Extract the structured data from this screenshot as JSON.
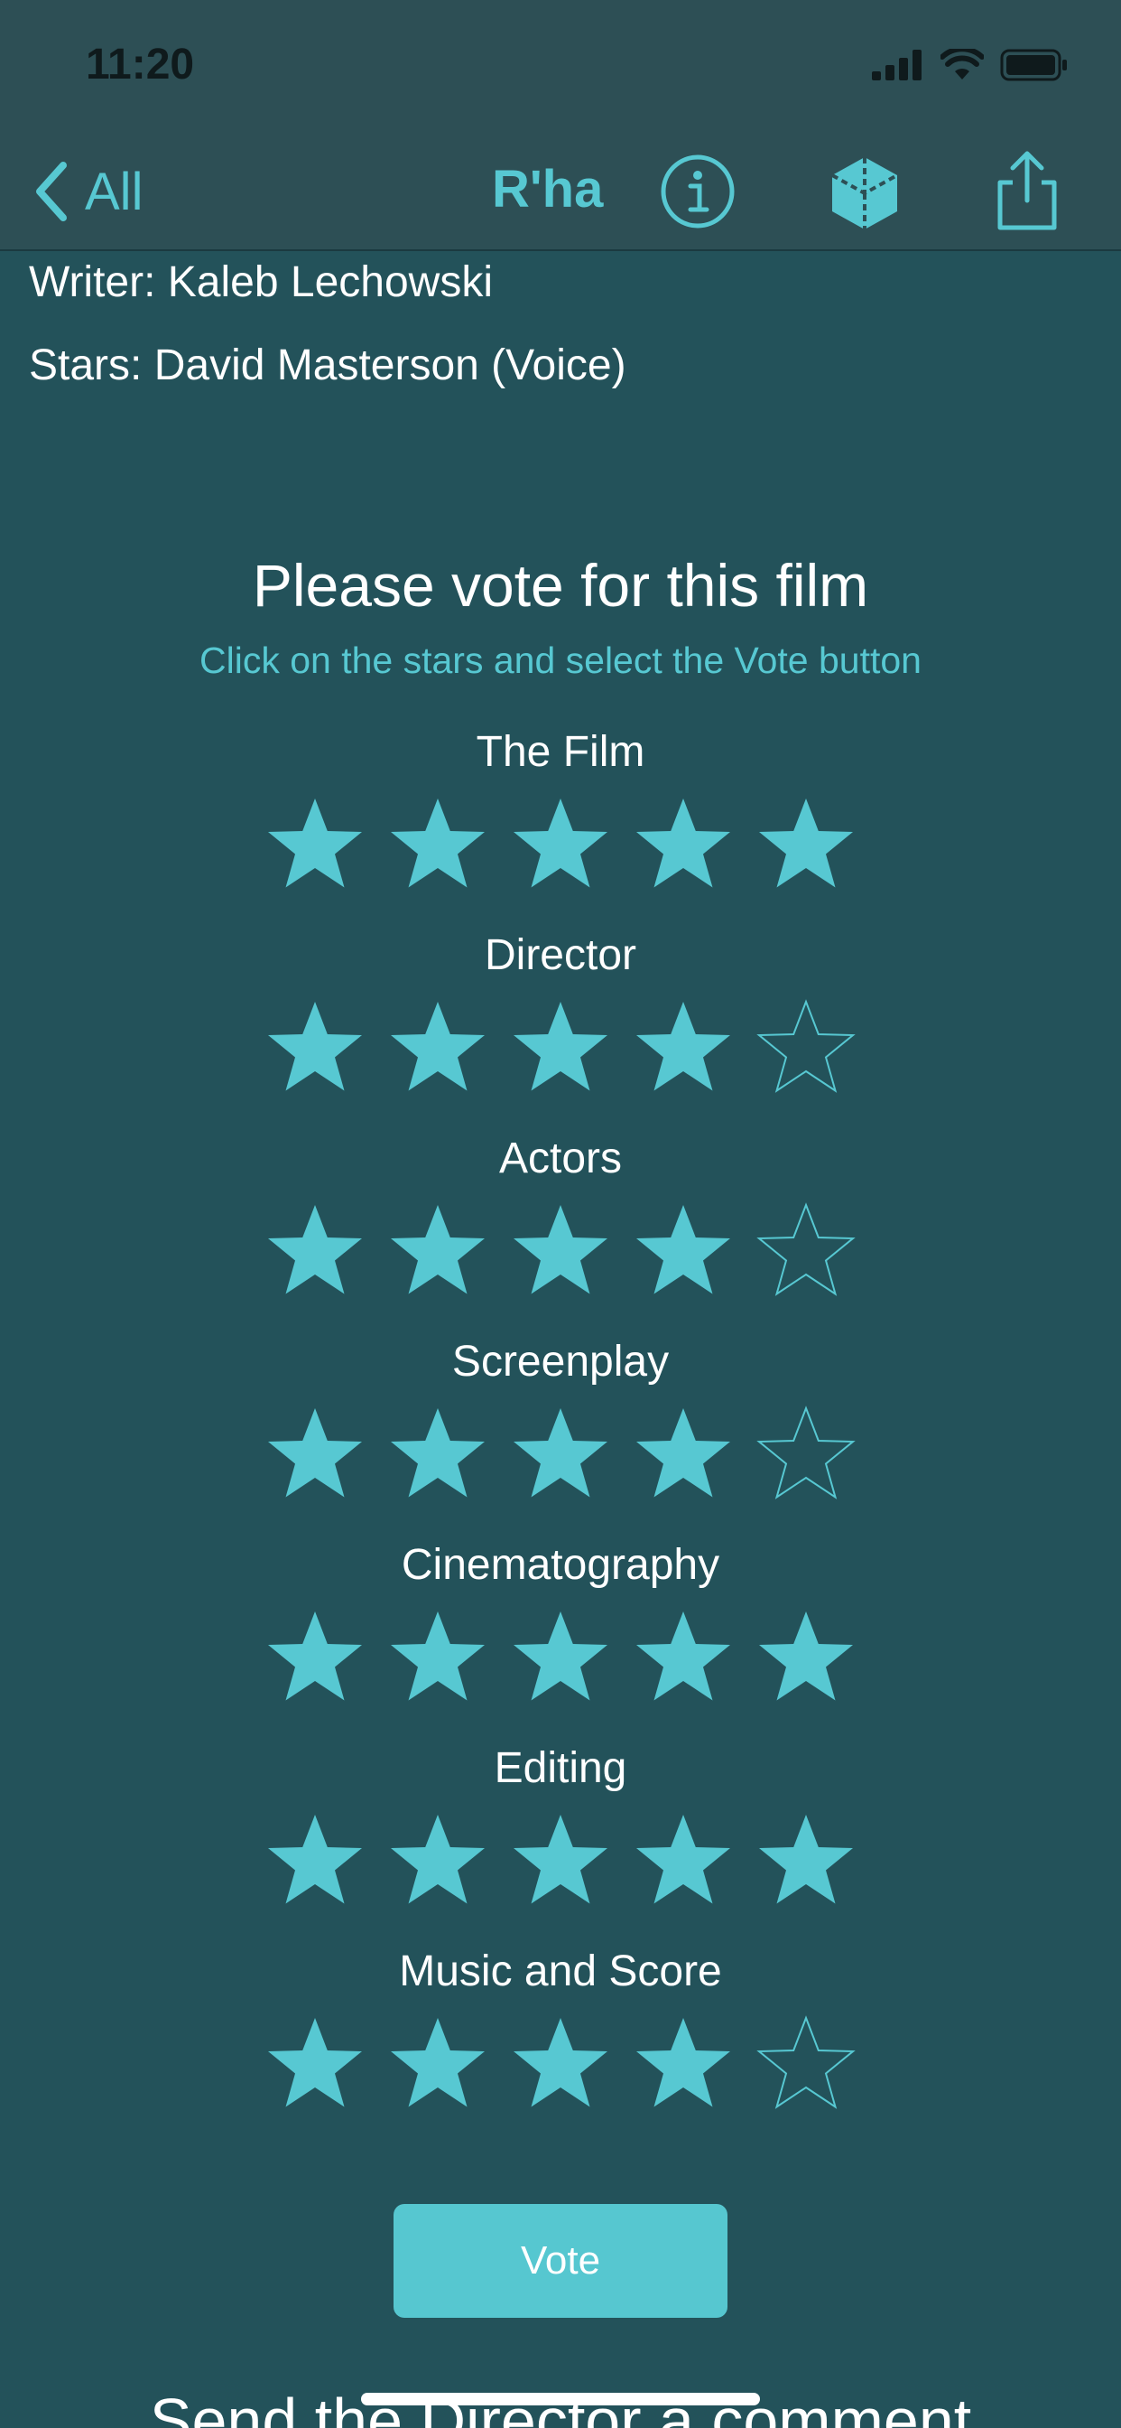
{
  "status_bar": {
    "time": "11:20"
  },
  "nav": {
    "back_label": "All",
    "title": "R'ha",
    "accent_color": "#57c8d2"
  },
  "credits": {
    "writer": "Writer: Kaleb Lechowski",
    "stars": "Stars: David Masterson (Voice)"
  },
  "vote": {
    "heading": "Please vote for this film",
    "subheading": "Click on the stars and select the Vote button",
    "categories": [
      {
        "label": "The Film",
        "rating": 5
      },
      {
        "label": "Director",
        "rating": 4
      },
      {
        "label": "Actors",
        "rating": 4
      },
      {
        "label": "Screenplay",
        "rating": 4
      },
      {
        "label": "Cinematography",
        "rating": 5
      },
      {
        "label": "Editing",
        "rating": 5
      },
      {
        "label": "Music and Score",
        "rating": 4
      }
    ],
    "max_rating": 5,
    "button_label": "Vote"
  },
  "footer": {
    "partial_text": "Send the Director a comment"
  }
}
